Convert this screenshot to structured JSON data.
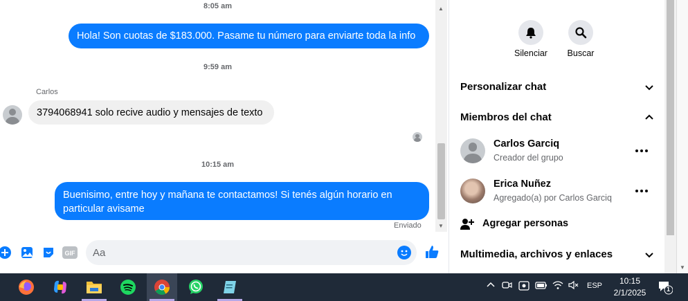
{
  "chat": {
    "timestamps": [
      "8:05 am",
      "9:59 am",
      "10:15 am"
    ],
    "messages": [
      {
        "direction": "out",
        "text": "Hola! Son cuotas de $183.000. Pasame tu número para enviarte toda la info"
      },
      {
        "direction": "in",
        "sender": "Carlos",
        "text": "3794068941 solo recive audio y mensajes de texto"
      },
      {
        "direction": "out",
        "text": "Buenisimo, entre hoy y mañana te contactamos! Si tenés algún horario en particular avisame"
      }
    ],
    "delivery_status": "Enviado"
  },
  "composer": {
    "placeholder": "Aa",
    "icons": [
      "plus-circle-icon",
      "photo-icon",
      "sticker-icon",
      "gif-icon",
      "emoji-icon",
      "thumbs-up-icon"
    ],
    "gif_label": "GIF"
  },
  "panel": {
    "actions": [
      {
        "label": "Silenciar",
        "icon": "bell-icon"
      },
      {
        "label": "Buscar",
        "icon": "search-icon"
      }
    ],
    "sections": {
      "customize": "Personalizar chat",
      "members": "Miembros del chat",
      "media": "Multimedia, archivos y enlaces"
    },
    "members": [
      {
        "name": "Carlos Garciq",
        "role": "Creador del grupo"
      },
      {
        "name": "Erica Nuñez",
        "role": "Agregado(a) por Carlos Garciq"
      }
    ],
    "add_people": "Agregar personas"
  },
  "taskbar": {
    "apps": [
      "firefox-icon",
      "copilot-icon",
      "file-explorer-icon",
      "spotify-icon",
      "chrome-icon",
      "whatsapp-icon",
      "notepad-icon"
    ],
    "language": "ESP",
    "time": "10:15",
    "date": "2/1/2025",
    "notification_count": "1"
  },
  "colors": {
    "accent": "#0a7cff",
    "taskbar": "#1f2a38"
  }
}
